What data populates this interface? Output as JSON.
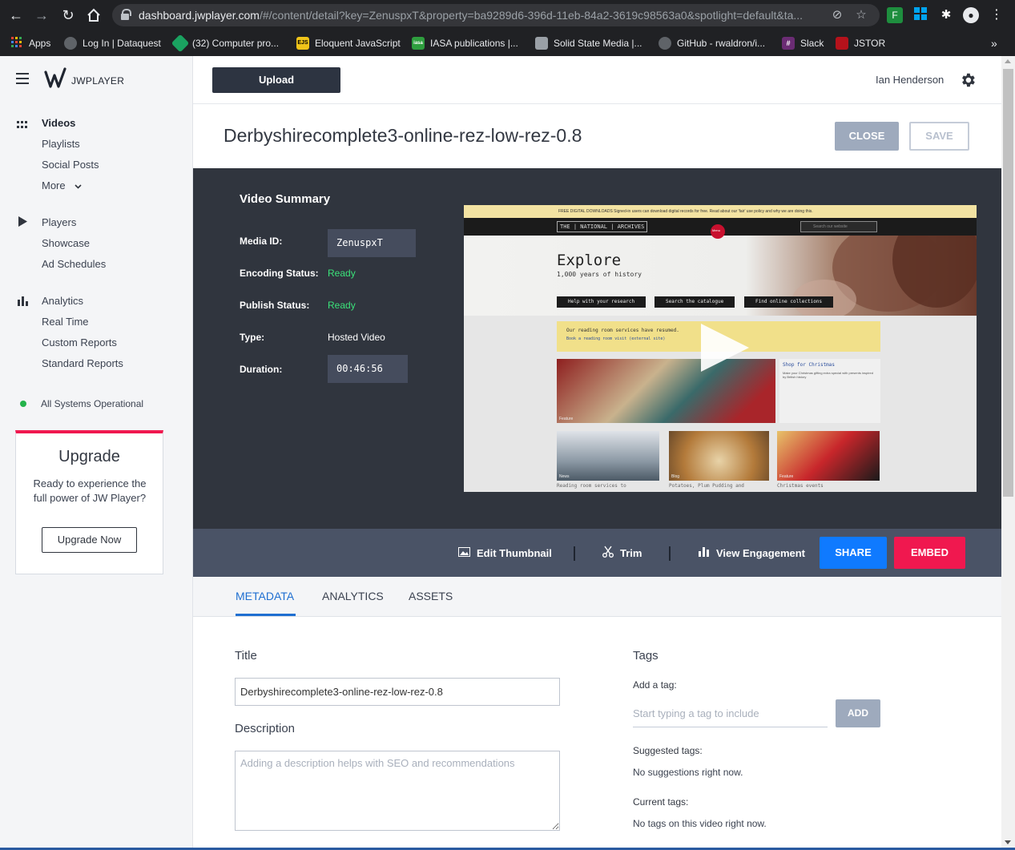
{
  "browser": {
    "url_host": "dashboard.jwplayer.com",
    "url_path": "/#/content/detail?key=ZenuspxT&property=ba9289d6-396d-11eb-84a2-3619c98563a0&spotlight=default&ta...",
    "bookmarks": [
      {
        "label": "Apps",
        "color": "#ea4335"
      },
      {
        "label": "Log In | Dataquest",
        "color": "#5f6368"
      },
      {
        "label": "(32) Computer pro...",
        "color": "#1aa260"
      },
      {
        "label": "Eloquent JavaScript",
        "color": "#f0c419",
        "glyph": "EJS"
      },
      {
        "label": "IASA publications |...",
        "color": "#2e9e3e",
        "glyph": "iasa"
      },
      {
        "label": "Solid State Media |...",
        "color": "#9aa0a6"
      },
      {
        "label": "GitHub - rwaldron/i...",
        "color": "#202124"
      },
      {
        "label": "Slack",
        "color": "#4a154b"
      },
      {
        "label": "JSTOR",
        "color": "#b5121b"
      }
    ]
  },
  "sidebar": {
    "brand": "JWPLAYER",
    "videos_section": [
      "Videos",
      "Playlists",
      "Social Posts",
      "More"
    ],
    "players_section": [
      "Players",
      "Showcase",
      "Ad Schedules"
    ],
    "analytics_section": [
      "Analytics",
      "Real Time",
      "Custom Reports",
      "Standard Reports"
    ],
    "system_status": "All Systems Operational",
    "upgrade": {
      "title": "Upgrade",
      "text": "Ready to experience the full power of JW Player?",
      "button": "Upgrade Now"
    }
  },
  "topbar": {
    "upload_label": "Upload",
    "user_name": "Ian Henderson"
  },
  "page": {
    "title": "Derbyshirecomplete3-online-rez-low-rez-0.8",
    "close_label": "CLOSE",
    "save_label": "SAVE"
  },
  "summary": {
    "heading": "Video Summary",
    "media_id_label": "Media ID:",
    "media_id": "ZenuspxT",
    "encoding_label": "Encoding Status:",
    "encoding_status": "Ready",
    "publish_label": "Publish Status:",
    "publish_status": "Ready",
    "type_label": "Type:",
    "type": "Hosted Video",
    "duration_label": "Duration:",
    "duration": "00:46:56",
    "status_color": "#3be27a"
  },
  "preview": {
    "topbar_text": "FREE DIGITAL DOWNLOADS   Signed-in users can download digital records for free. Read about our 'fair' use policy and why we are doing this.",
    "site_logo": "THE | NATIONAL | ARCHIVES",
    "search_placeholder": "Search our website",
    "menu_label": "Menu",
    "hero_title": "Explore",
    "hero_subtitle": "1,000 years of history",
    "buttons": [
      "Help with your research",
      "Search the catalogue",
      "Find online collections"
    ],
    "notice_title": "Our reading room services have resumed.",
    "notice_link": "Book a reading room visit (external site)",
    "side_title": "Shop for Christmas",
    "side_text": "Make your Christmas gifting extra special with presents inspired by British history",
    "tile_captions": [
      "Reading room services to",
      "Potatoes, Plum Pudding and",
      "Christmas events"
    ],
    "tile_tag": "Feature",
    "tile_tag_news": "News",
    "tile_tag_blog": "Blog"
  },
  "actions": {
    "edit_thumbnail": "Edit Thumbnail",
    "trim": "Trim",
    "view_engagement": "View Engagement",
    "share": "SHARE",
    "embed": "EMBED"
  },
  "tabs": [
    "METADATA",
    "ANALYTICS",
    "ASSETS"
  ],
  "metadata": {
    "title_label": "Title",
    "title_value": "Derbyshirecomplete3-online-rez-low-rez-0.8",
    "description_label": "Description",
    "description_placeholder": "Adding a description helps with SEO and recommendations",
    "tags_label": "Tags",
    "add_tag_label": "Add a tag:",
    "tag_placeholder": "Start typing a tag to include",
    "add_button": "ADD",
    "suggested_label": "Suggested tags:",
    "suggested_text": "No suggestions right now.",
    "current_label": "Current tags:",
    "current_text": "No tags on this video right now."
  },
  "colors": {
    "accent_blue": "#0f7aff",
    "accent_red": "#f0184f",
    "dark_panel": "#30353e"
  }
}
